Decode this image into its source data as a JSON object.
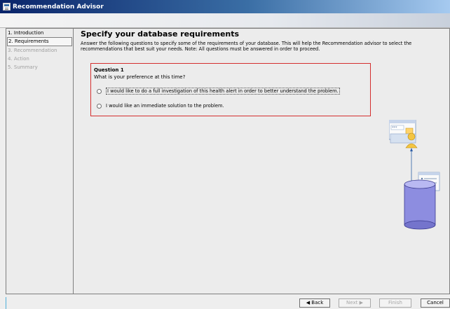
{
  "window": {
    "title": "Recommendation Advisor"
  },
  "nav": {
    "items": [
      {
        "label": "1. Introduction",
        "state": "active"
      },
      {
        "label": "2. Requirements",
        "state": "selected"
      },
      {
        "label": "3. Recommendation",
        "state": "disabled"
      },
      {
        "label": "4. Action",
        "state": "disabled"
      },
      {
        "label": "5. Summary",
        "state": "disabled"
      }
    ]
  },
  "main": {
    "title": "Specify your database requirements",
    "description": "Answer the following questions to specify some of the requirements of your database. This will help the Recommendation advisor to select the recommendations that best suit your needs. Note: All questions must be answered in order to proceed."
  },
  "question": {
    "label": "Question 1",
    "text": "What is your preference at this time?",
    "options": [
      {
        "label": "I would like to do a full investigation of this health alert in order to better understand the problem.",
        "checked": false
      },
      {
        "label": "I would like an immediate solution to the problem.",
        "checked": false
      }
    ]
  },
  "buttons": {
    "back": "◀ Back",
    "next": "Next ▶",
    "finish": "Finish",
    "cancel": "Cancel"
  },
  "colors": {
    "titlebar": "#0a246a",
    "question_border": "#d42e2e",
    "database": "#8d8de0"
  },
  "icons": [
    "window-icon",
    "recommendation-sheet-icon",
    "user-icon",
    "database-icon",
    "list-icon"
  ]
}
